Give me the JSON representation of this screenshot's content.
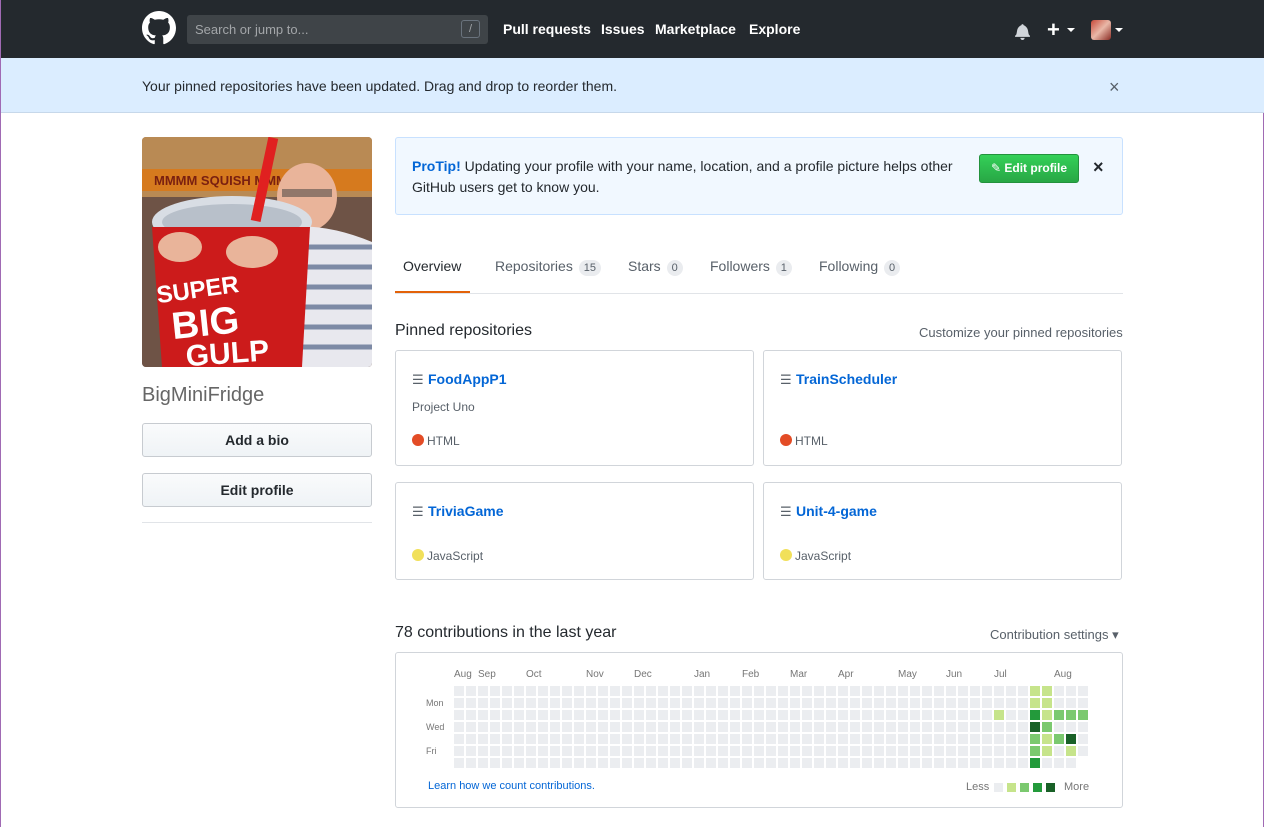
{
  "header": {
    "search_placeholder": "Search or jump to...",
    "slash_hint": "/",
    "nav": [
      "Pull requests",
      "Issues",
      "Marketplace",
      "Explore"
    ],
    "icons": [
      "github-logo-icon",
      "bell-icon",
      "plus-icon",
      "avatar"
    ]
  },
  "flash": {
    "message": "Your pinned repositories have been updated. Drag and drop to reorder them.",
    "close": "×"
  },
  "profile": {
    "username": "BigMiniFridge",
    "add_bio": "Add a bio",
    "edit_profile": "Edit profile",
    "avatar_text_1": "SUPER",
    "avatar_text_2": "BIG",
    "avatar_text_3": "GULP",
    "avatar_sign": "MMMM SQUISH MMMM"
  },
  "protip": {
    "label": "ProTip!",
    "text": " Updating your profile with your name, location, and a profile picture helps other GitHub users get to know you.",
    "button": "Edit profile",
    "close": "×"
  },
  "tabs": [
    {
      "label": "Overview",
      "count": null
    },
    {
      "label": "Repositories",
      "count": "15"
    },
    {
      "label": "Stars",
      "count": "0"
    },
    {
      "label": "Followers",
      "count": "1"
    },
    {
      "label": "Following",
      "count": "0"
    }
  ],
  "pinned": {
    "title": "Pinned repositories",
    "customize": "Customize your pinned repositories",
    "repos": [
      {
        "name": "FoodAppP1",
        "description": "Project Uno",
        "language": "HTML",
        "color": "#e34c26"
      },
      {
        "name": "TrainScheduler",
        "description": "",
        "language": "HTML",
        "color": "#e34c26"
      },
      {
        "name": "TriviaGame",
        "description": "",
        "language": "JavaScript",
        "color": "#f1e05a"
      },
      {
        "name": "Unit-4-game",
        "description": "",
        "language": "JavaScript",
        "color": "#f1e05a"
      }
    ]
  },
  "contributions": {
    "title": "78 contributions in the last year",
    "settings": "Contribution settings ▾",
    "months": [
      "Aug",
      "Sep",
      "Oct",
      "Nov",
      "Dec",
      "Jan",
      "Feb",
      "Mar",
      "Apr",
      "May",
      "Jun",
      "Jul",
      "Aug"
    ],
    "days": [
      "Mon",
      "Wed",
      "Fri"
    ],
    "learn_link": "Learn how we count contributions.",
    "less": "Less",
    "more": "More",
    "colors": [
      "#ebedf0",
      "#c6e48b",
      "#7bc96f",
      "#239a3b",
      "#196127"
    ]
  }
}
